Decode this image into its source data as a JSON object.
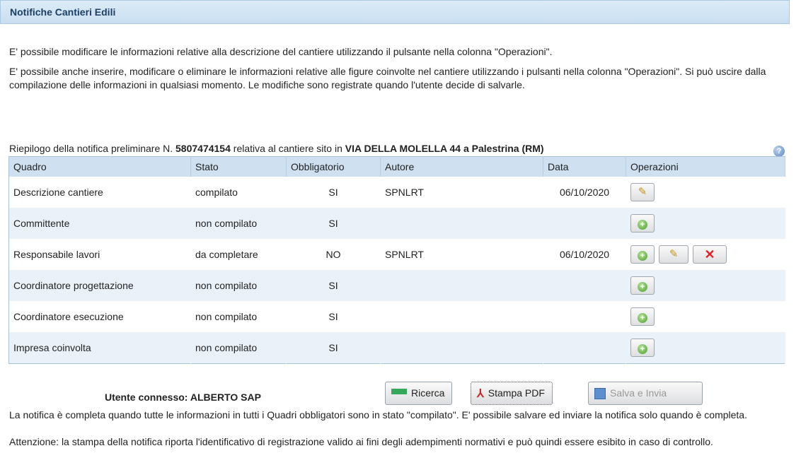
{
  "title": "Notifiche Cantieri Edili",
  "info": {
    "p1": "E' possibile modificare le informazioni relative alla descrizione del cantiere utilizzando il pulsante nella colonna \"Operazioni\".",
    "p2": "E' possibile anche inserire, modificare o eliminare le informazioni relative alle figure coinvolte nel cantiere utilizzando i pulsanti nella colonna \"Operazioni\". Si può uscire dalla compilazione delle informazioni in qualsiasi momento. Le modifiche sono registrate quando l'utente decide di salvarle."
  },
  "summary": {
    "prefix": "Riepilogo della notifica preliminare N. ",
    "number": "5807474154",
    "middle": " relativa al cantiere sito in ",
    "location": "VIA DELLA MOLELLA 44 a Palestrina (RM)"
  },
  "table": {
    "headers": [
      "Quadro",
      "Stato",
      "Obbligatorio",
      "Autore",
      "Data",
      "Operazioni"
    ],
    "rows": [
      {
        "quadro": "Descrizione cantiere",
        "stato": "compilato",
        "obbligatorio": "SI",
        "autore": "SPNLRT",
        "data": "06/10/2020"
      },
      {
        "quadro": "Committente",
        "stato": "non compilato",
        "obbligatorio": "SI",
        "autore": "",
        "data": ""
      },
      {
        "quadro": "Responsabile lavori",
        "stato": "da completare",
        "obbligatorio": "NO",
        "autore": "SPNLRT",
        "data": "06/10/2020"
      },
      {
        "quadro": "Coordinatore progettazione",
        "stato": "non compilato",
        "obbligatorio": "SI",
        "autore": "",
        "data": ""
      },
      {
        "quadro": "Coordinatore esecuzione",
        "stato": "non compilato",
        "obbligatorio": "SI",
        "autore": "",
        "data": ""
      },
      {
        "quadro": "Impresa coinvolta",
        "stato": "non compilato",
        "obbligatorio": "SI",
        "autore": "",
        "data": ""
      }
    ]
  },
  "footer": {
    "user": "Utente connesso: ALBERTO SAP",
    "buttons": {
      "ricerca": "Ricerca",
      "stampa": "Stampa PDF",
      "salva": "Salva e Invia"
    },
    "note1": "La notifica è completa quando tutte le informazioni in tutti i Quadri obbligatori sono in stato \"compilato\". E' possibile salvare ed inviare la notifica solo quando è completa.",
    "note2": "Attenzione: la stampa della notifica riporta l'identificativo di registrazione valido ai fini degli adempimenti normativi e può quindi essere esibito in caso di controllo."
  },
  "icons": {
    "help": "help-icon",
    "edit": "pencil-icon",
    "add": "add-icon",
    "delete": "delete-icon"
  }
}
